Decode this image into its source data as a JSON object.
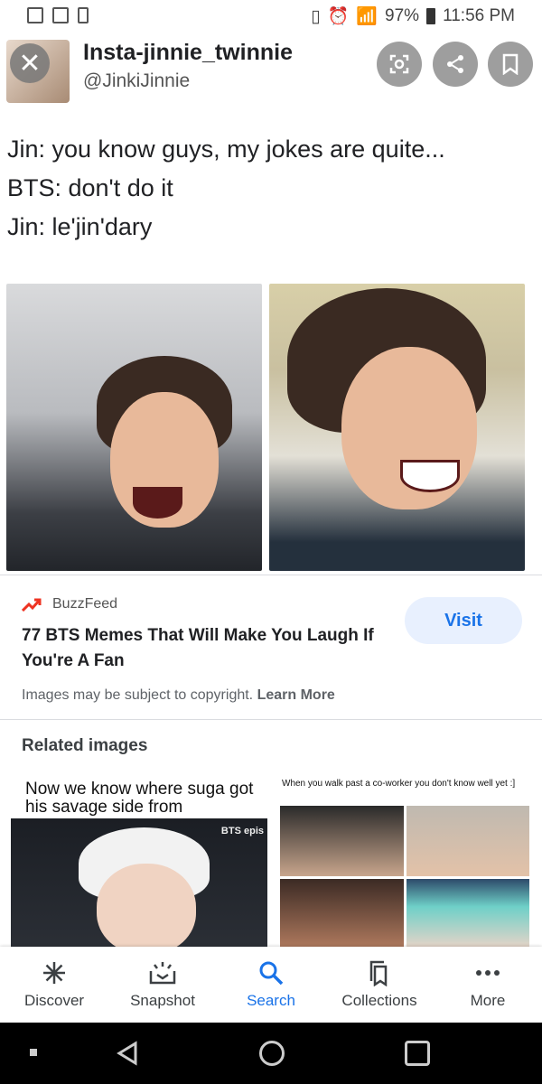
{
  "status_bar": {
    "battery": "97%",
    "time": "11:56 PM"
  },
  "tweet": {
    "display_name": "Insta-jinnie_twinnie",
    "handle": "@JinkiJinnie",
    "lines": [
      "Jin: you know guys, my jokes are quite...",
      "BTS: don't do it",
      "Jin: le'jin'dary"
    ]
  },
  "result": {
    "source": "BuzzFeed",
    "title": "77 BTS Memes That Will Make You Laugh If You're A Fan",
    "visit_label": "Visit",
    "copyright_text": "Images may be subject to copyright.",
    "learn_more_label": "Learn More"
  },
  "related": {
    "title": "Related images",
    "items": [
      {
        "caption": "Now we know where suga got his savage side from",
        "overlay": "BTS epis"
      },
      {
        "caption": "When you walk past a co-worker you don't know well yet :]"
      }
    ]
  },
  "bottom_nav": [
    {
      "label": "Discover",
      "icon": "asterisk-icon"
    },
    {
      "label": "Snapshot",
      "icon": "snapshot-icon"
    },
    {
      "label": "Search",
      "icon": "search-icon",
      "active": true
    },
    {
      "label": "Collections",
      "icon": "collections-icon"
    },
    {
      "label": "More",
      "icon": "more-dots-icon"
    }
  ],
  "colors": {
    "accent": "#1a73e8",
    "visit_bg": "#e8f0fe",
    "buzzfeed": "#ee3322"
  }
}
